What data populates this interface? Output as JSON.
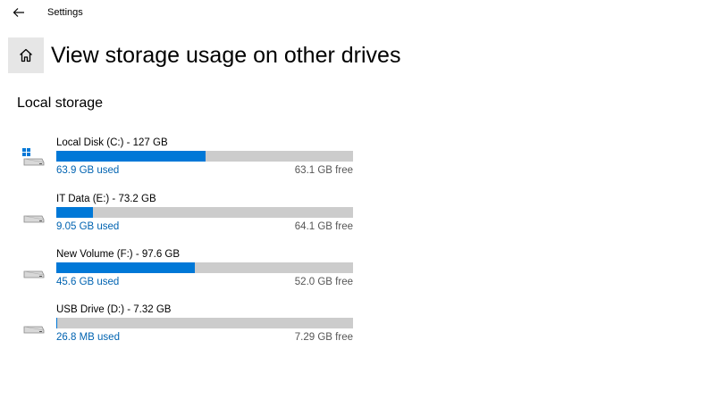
{
  "window": {
    "title": "Settings"
  },
  "page": {
    "title": "View storage usage on other drives"
  },
  "section": {
    "title": "Local storage"
  },
  "colors": {
    "accent": "#0078d7",
    "bar_track": "#cccccc",
    "used_text": "#0063b1",
    "free_text": "#555555",
    "home_button_bg": "#e6e6e6"
  },
  "drives": [
    {
      "name": "Local Disk (C:) - 127 GB",
      "used": "63.9 GB used",
      "free": "63.1 GB free",
      "fraction_used": 0.503,
      "icon": "windows-drive-icon"
    },
    {
      "name": "IT Data (E:) - 73.2 GB",
      "used": "9.05 GB used",
      "free": "64.1 GB free",
      "fraction_used": 0.124,
      "icon": "drive-icon"
    },
    {
      "name": "New Volume (F:) - 97.6 GB",
      "used": "45.6 GB used",
      "free": "52.0 GB free",
      "fraction_used": 0.467,
      "icon": "drive-icon"
    },
    {
      "name": "USB Drive (D:) - 7.32 GB",
      "used": "26.8 MB used",
      "free": "7.29 GB free",
      "fraction_used": 0.004,
      "icon": "drive-icon"
    }
  ]
}
